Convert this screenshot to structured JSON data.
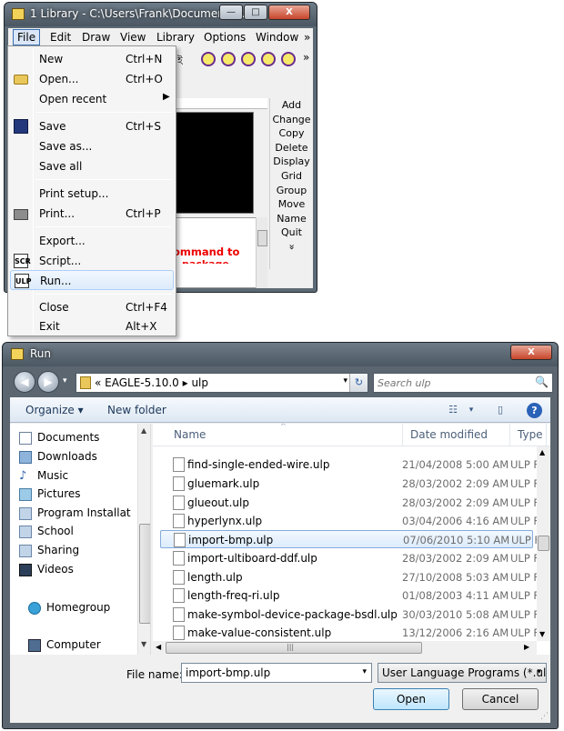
{
  "library_window": {
    "title": "1 Library - C:\\Users\\Frank\\Documents\\...",
    "caption_buttons": {
      "minimize": "—",
      "maximize": "□",
      "close": "X"
    },
    "menubar": [
      "File",
      "Edit",
      "Draw",
      "View",
      "Library",
      "Options",
      "Window",
      "»"
    ],
    "toolbar_more": "»",
    "toolbar_fragment": "ই",
    "commands": [
      "Add",
      "Change",
      "Copy",
      "Delete",
      "Display",
      "Grid",
      "Group",
      "Move",
      "Name",
      "Quit"
    ],
    "commands_more": "»",
    "description_text": "ommand to",
    "description_text2": "package"
  },
  "file_menu": {
    "items": [
      {
        "label": "New",
        "shortcut": "Ctrl+N"
      },
      {
        "label": "Open...",
        "shortcut": "Ctrl+O"
      },
      {
        "label": "Open recent",
        "shortcut": "",
        "submenu_arrow": "▶"
      },
      {
        "label": "Save",
        "shortcut": "Ctrl+S"
      },
      {
        "label": "Save as...",
        "shortcut": ""
      },
      {
        "label": "Save all",
        "shortcut": ""
      },
      {
        "label": "Print setup...",
        "shortcut": ""
      },
      {
        "label": "Print...",
        "shortcut": "Ctrl+P"
      },
      {
        "label": "Export...",
        "shortcut": ""
      },
      {
        "label": "Script...",
        "shortcut": ""
      },
      {
        "label": "Run...",
        "shortcut": ""
      },
      {
        "label": "Close",
        "shortcut": "Ctrl+F4"
      },
      {
        "label": "Exit",
        "shortcut": "Alt+X"
      }
    ],
    "icon_texts": {
      "script": "SCR",
      "run": "ULP"
    }
  },
  "run_dialog": {
    "title": "Run",
    "close_label": "X",
    "nav": {
      "back": "◀",
      "forward": "▶",
      "history": "▾"
    },
    "address": {
      "path": "« EAGLE-5.10.0 ▸ ulp",
      "dropdown": "▾",
      "refresh": "↻"
    },
    "search": {
      "placeholder": "Search ulp",
      "icon": "🔍"
    },
    "toolbar": {
      "organize": "Organize ▾",
      "new_folder": "New folder",
      "view": "☷",
      "view_dd": "▾",
      "preview": "▯",
      "help": "?"
    },
    "nav_pane": [
      {
        "label": "Documents",
        "icon": "documents-icon"
      },
      {
        "label": "Downloads",
        "icon": "downloads-icon"
      },
      {
        "label": "Music",
        "icon": "music-icon"
      },
      {
        "label": "Pictures",
        "icon": "pictures-icon"
      },
      {
        "label": "Program Installat",
        "icon": "folder-icon"
      },
      {
        "label": "School",
        "icon": "folder-icon"
      },
      {
        "label": "Sharing",
        "icon": "folder-icon"
      },
      {
        "label": "Videos",
        "icon": "videos-icon"
      },
      {
        "label": "Homegroup",
        "icon": "homegroup-icon"
      },
      {
        "label": "Computer",
        "icon": "computer-icon"
      }
    ],
    "columns": {
      "name": "Name",
      "date": "Date modified",
      "type": "Type"
    },
    "files": [
      {
        "name": "find-single-ended-wire.ulp",
        "date": "21/04/2008 5:00 AM",
        "type": "ULP Fi"
      },
      {
        "name": "gluemark.ulp",
        "date": "28/03/2002 2:09 AM",
        "type": "ULP Fi"
      },
      {
        "name": "glueout.ulp",
        "date": "28/03/2002 2:09 AM",
        "type": "ULP Fi"
      },
      {
        "name": "hyperlynx.ulp",
        "date": "03/04/2006 4:16 AM",
        "type": "ULP Fi"
      },
      {
        "name": "import-bmp.ulp",
        "date": "07/06/2010 5:10 AM",
        "type": "ULP Fi",
        "selected": true
      },
      {
        "name": "import-ultiboard-ddf.ulp",
        "date": "28/03/2002 2:09 AM",
        "type": "ULP Fi"
      },
      {
        "name": "length.ulp",
        "date": "27/10/2008 5:03 AM",
        "type": "ULP Fi"
      },
      {
        "name": "length-freq-ri.ulp",
        "date": "01/08/2003 4:11 AM",
        "type": "ULP Fi"
      },
      {
        "name": "make-symbol-device-package-bsdl.ulp",
        "date": "30/03/2010 5:08 AM",
        "type": "ULP Fi"
      },
      {
        "name": "make-value-consistent.ulp",
        "date": "13/12/2006 2:16 AM",
        "type": "ULP Fi"
      }
    ],
    "filename_label": "File name:",
    "filename_value": "import-bmp.ulp",
    "filetype_value": "User Language Programs (*.ulp",
    "open_label": "Open",
    "cancel_label": "Cancel",
    "scroll": {
      "up": "▲",
      "down": "▼",
      "hscroll_grip": "|||"
    }
  }
}
